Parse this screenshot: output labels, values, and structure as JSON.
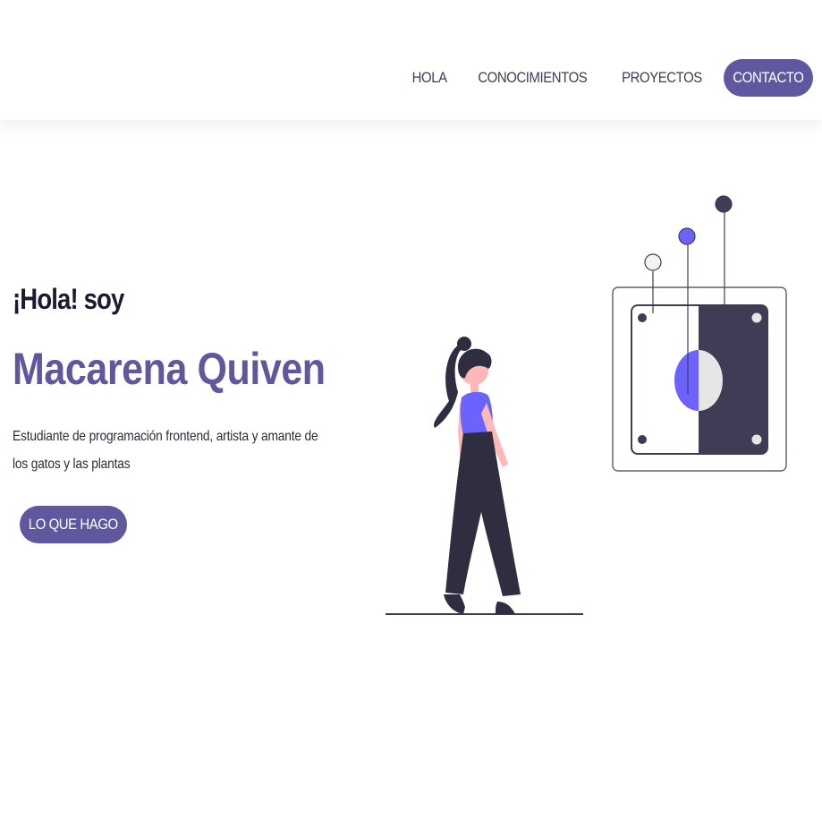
{
  "nav": {
    "items": [
      {
        "label": "HOLA"
      },
      {
        "label": "CONOCIMIENTOS"
      },
      {
        "label": "PROYECTOS"
      }
    ],
    "contact_label": "CONTACTO"
  },
  "hero": {
    "greeting": "¡Hola! soy",
    "name": "Macarena Quiven",
    "bio": "Estudiante de programación frontend, artista y amante de los gatos y las plantas",
    "cta_label": "LO QUE HAGO"
  },
  "colors": {
    "accent": "#5f589e",
    "illustration_purple": "#6c63ff",
    "illustration_dark": "#3f3d56",
    "skin": "#ffb8b8"
  },
  "icons": {
    "illustration": "woman-with-control-panel-illustration"
  }
}
